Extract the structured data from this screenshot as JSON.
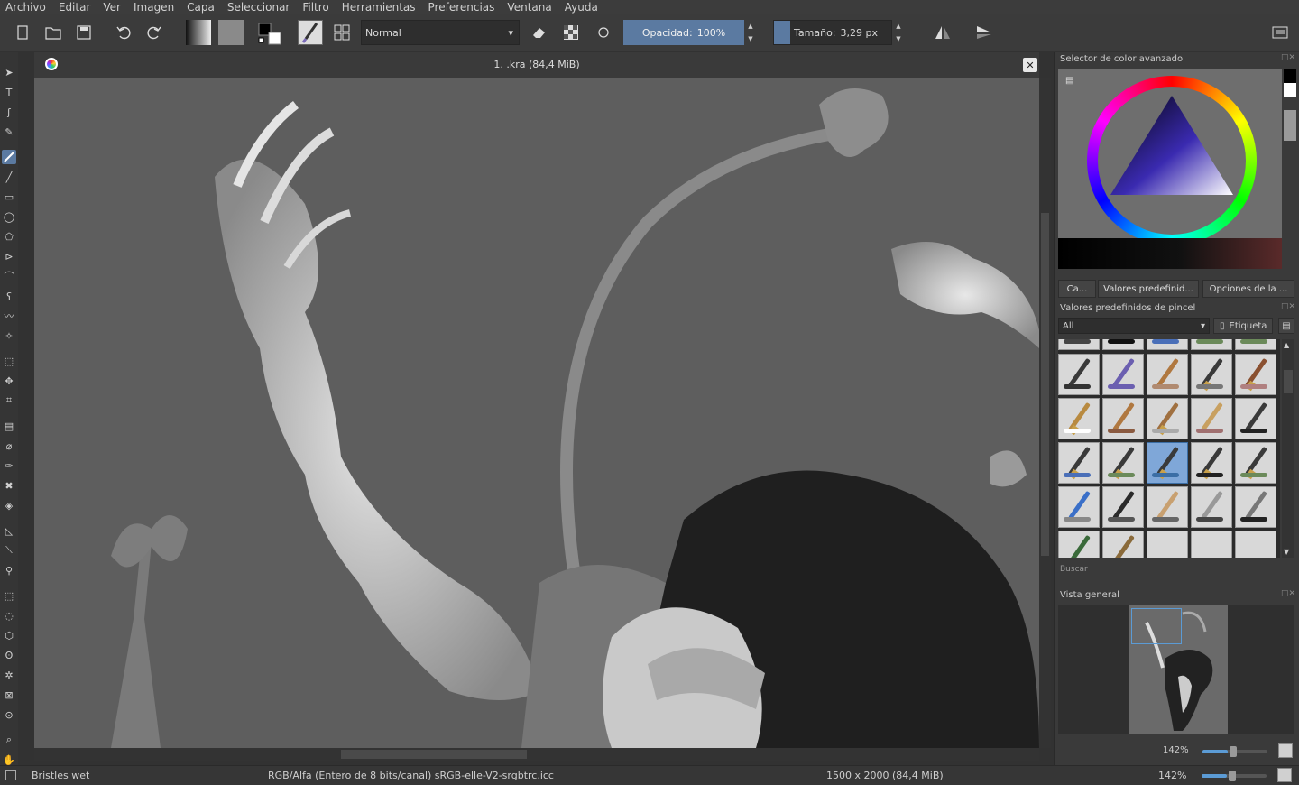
{
  "menu": [
    "Archivo",
    "Editar",
    "Ver",
    "Imagen",
    "Capa",
    "Seleccionar",
    "Filtro",
    "Herramientas",
    "Preferencias",
    "Ventana",
    "Ayuda"
  ],
  "toolbar": {
    "blend_mode": "Normal",
    "opacity_label": "Opacidad:",
    "opacity_value": "100%",
    "size_label": "Tamaño:",
    "size_value": "3,29 px"
  },
  "document": {
    "title": "1. .kra (84,4 MiB)"
  },
  "dock": {
    "color_selector_title": "Selector de color avanzado",
    "tabs": [
      "Ca...",
      "Valores predefinid...",
      "Opciones de la ..."
    ],
    "brush_presets_title": "Valores predefinidos de pincel",
    "tag_filter": "All",
    "tag_button": "Etiqueta",
    "search_label": "Buscar",
    "overview_title": "Vista general",
    "overview_zoom": "142%"
  },
  "status": {
    "brush_name": "Bristles wet",
    "color_space": "RGB/Alfa (Entero de 8 bits/canal)  sRGB-elle-V2-srgbtrc.icc",
    "image_size": "1500 x 2000 (84,4 MiB)",
    "zoom": "142%"
  },
  "colors": {
    "accent": "#5b7aa1",
    "canvas_bg": "#5e5e5e",
    "panel_bg": "#3a3a3a"
  }
}
